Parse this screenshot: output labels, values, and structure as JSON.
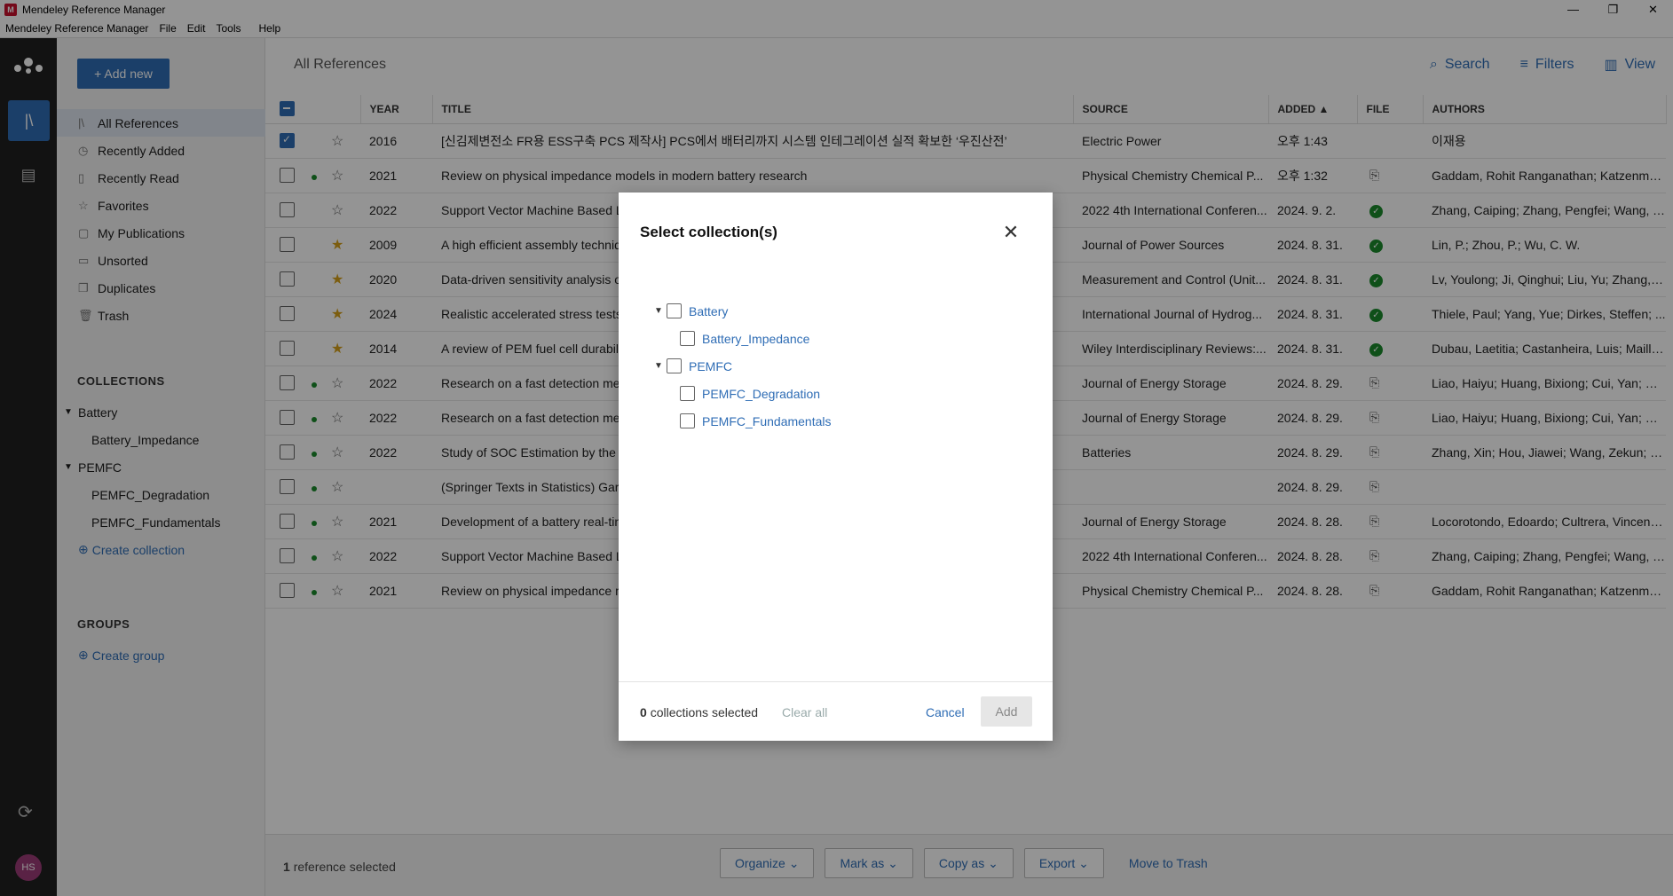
{
  "window": {
    "title": "Mendeley Reference Manager",
    "controls": [
      "—",
      "❐",
      "✕"
    ]
  },
  "menubar": [
    "Mendeley Reference Manager",
    "File",
    "Edit",
    "Tools",
    "Help"
  ],
  "rail": {
    "avatar_initials": "HS"
  },
  "sidebar": {
    "add_new": "+ Add new",
    "nav": [
      {
        "label": "All References",
        "icon": "library-icon"
      },
      {
        "label": "Recently Added",
        "icon": "clock-icon"
      },
      {
        "label": "Recently Read",
        "icon": "bookmark-icon"
      },
      {
        "label": "Favorites",
        "icon": "star-icon"
      },
      {
        "label": "My Publications",
        "icon": "document-icon"
      },
      {
        "label": "Unsorted",
        "icon": "inbox-icon"
      },
      {
        "label": "Duplicates",
        "icon": "duplicate-icon"
      },
      {
        "label": "Trash",
        "icon": "trash-icon"
      }
    ],
    "collections_header": "COLLECTIONS",
    "collections": [
      {
        "label": "Battery",
        "level": 0
      },
      {
        "label": "Battery_Impedance",
        "level": 1
      },
      {
        "label": "PEMFC",
        "level": 0
      },
      {
        "label": "PEMFC_Degradation",
        "level": 1
      },
      {
        "label": "PEMFC_Fundamentals",
        "level": 1
      }
    ],
    "create_collection": "Create collection",
    "groups_header": "GROUPS",
    "create_group": "Create group"
  },
  "main": {
    "heading": "All References",
    "tools": {
      "search": "Search",
      "filters": "Filters",
      "view": "View"
    },
    "columns": [
      "YEAR",
      "TITLE",
      "SOURCE",
      "ADDED ▲",
      "FILE",
      "AUTHORS"
    ],
    "rows": [
      {
        "checked": true,
        "dot": false,
        "fav": false,
        "year": "2016",
        "title": "[신김제변전소 FR용 ESS구축 PCS 제작사] PCS에서 배터리까지 시스템 인테그레이션 실적 확보한 ‘우진산전’",
        "source": "Electric Power",
        "added": "오후 1:43",
        "file": "",
        "authors": "이재용"
      },
      {
        "checked": false,
        "dot": true,
        "fav": false,
        "year": "2021",
        "title": "Review on physical impedance models in modern battery research",
        "source": "Physical Chemistry Chemical P...",
        "added": "오후 1:32",
        "file": "add",
        "authors": "Gaddam, Rohit Ranganathan; Katzenmei..."
      },
      {
        "checked": false,
        "dot": false,
        "fav": false,
        "year": "2022",
        "title": "Support Vector Machine Based L",
        "source": "2022 4th International Conferen...",
        "added": "2024. 9. 2.",
        "file": "ok",
        "authors": "Zhang, Caiping; Zhang, Pengfei; Wang, Y..."
      },
      {
        "checked": false,
        "dot": false,
        "fav": true,
        "year": "2009",
        "title": "A high efficient assembly techniq",
        "source": "Journal of Power Sources",
        "added": "2024. 8. 31.",
        "file": "ok",
        "authors": "Lin, P.; Zhou, P.; Wu, C. W."
      },
      {
        "checked": false,
        "dot": false,
        "fav": true,
        "year": "2020",
        "title": "Data-driven sensitivity analysis o",
        "source": "Measurement and Control (Unit...",
        "added": "2024. 8. 31.",
        "file": "ok",
        "authors": "Lv, Youlong; Ji, Qinghui; Liu, Yu; Zhang, Jie"
      },
      {
        "checked": false,
        "dot": false,
        "fav": true,
        "year": "2024",
        "title": "Realistic accelerated stress tests",
        "source": "International Journal of Hydrog...",
        "added": "2024. 8. 31.",
        "file": "ok",
        "authors": "Thiele, Paul; Yang, Yue; Dirkes, Steffen; ..."
      },
      {
        "checked": false,
        "dot": false,
        "fav": true,
        "year": "2014",
        "title": "A review of PEM fuel cell durabili",
        "source": "Wiley Interdisciplinary Reviews:...",
        "added": "2024. 8. 31.",
        "file": "ok",
        "authors": "Dubau, Laetitia; Castanheira, Luis; Mailla..."
      },
      {
        "checked": false,
        "dot": true,
        "fav": false,
        "year": "2022",
        "title": "Research on a fast detection me",
        "source": "Journal of Energy Storage",
        "added": "2024. 8. 29.",
        "file": "add",
        "authors": "Liao, Haiyu; Huang, Bixiong; Cui, Yan; Qi..."
      },
      {
        "checked": false,
        "dot": true,
        "fav": false,
        "year": "2022",
        "title": "Research on a fast detection me",
        "source": "Journal of Energy Storage",
        "added": "2024. 8. 29.",
        "file": "add",
        "authors": "Liao, Haiyu; Huang, Bixiong; Cui, Yan; Qi..."
      },
      {
        "checked": false,
        "dot": true,
        "fav": false,
        "year": "2022",
        "title": "Study of SOC Estimation by the A",
        "source": "Batteries",
        "added": "2024. 8. 29.",
        "file": "add",
        "authors": "Zhang, Xin; Hou, Jiawei; Wang, Zekun; Ji..."
      },
      {
        "checked": false,
        "dot": true,
        "fav": false,
        "year": "",
        "title": "(Springer Texts in Statistics) Gar",
        "source": "",
        "added": "2024. 8. 29.",
        "file": "add",
        "authors": ""
      },
      {
        "checked": false,
        "dot": true,
        "fav": false,
        "year": "2021",
        "title": "Development of a battery real-tin",
        "source": "Journal of Energy Storage",
        "added": "2024. 8. 28.",
        "file": "add",
        "authors": "Locorotondo, Edoardo; Cultrera, Vincenz..."
      },
      {
        "checked": false,
        "dot": true,
        "fav": false,
        "year": "2022",
        "title": "Support Vector Machine Based L",
        "source": "2022 4th International Conferen...",
        "added": "2024. 8. 28.",
        "file": "add",
        "authors": "Zhang, Caiping; Zhang, Pengfei; Wang, Y..."
      },
      {
        "checked": false,
        "dot": true,
        "fav": false,
        "year": "2021",
        "title": "Review on physical impedance m",
        "source": "Physical Chemistry Chemical P...",
        "added": "2024. 8. 28.",
        "file": "add",
        "authors": "Gaddam, Rohit Ranganathan; Katzenmei..."
      }
    ]
  },
  "bottombar": {
    "selected_count": "1",
    "selected_label": "reference selected",
    "organize": "Organize ⌄",
    "mark_as": "Mark as ⌄",
    "copy_as": "Copy as ⌄",
    "export": "Export ⌄",
    "move_to_trash": "Move to Trash"
  },
  "modal": {
    "title": "Select collection(s)",
    "tree": [
      {
        "label": "Battery",
        "level": 0,
        "expanded": true
      },
      {
        "label": "Battery_Impedance",
        "level": 1
      },
      {
        "label": "PEMFC",
        "level": 0,
        "expanded": true
      },
      {
        "label": "PEMFC_Degradation",
        "level": 1
      },
      {
        "label": "PEMFC_Fundamentals",
        "level": 1
      }
    ],
    "count": "0",
    "count_label": "collections selected",
    "clear_all": "Clear all",
    "cancel": "Cancel",
    "add": "Add"
  },
  "colors": {
    "accent": "#2f6db5",
    "rail": "#1f1f1f",
    "star": "#d6a11b",
    "file_ok": "#1a8a2c"
  }
}
